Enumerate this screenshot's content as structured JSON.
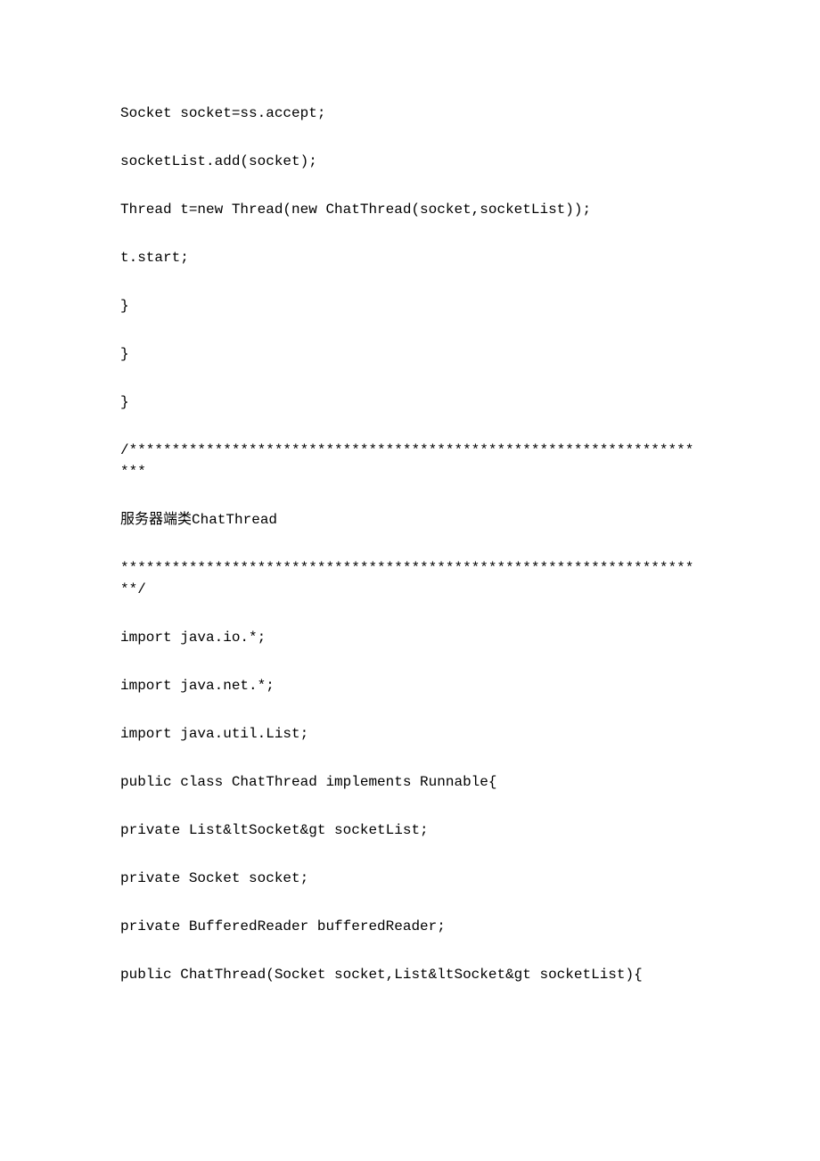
{
  "lines": [
    "Socket socket=ss.accept;",
    "socketList.add(socket);",
    "Thread t=new Thread(new ChatThread(socket,socketList));",
    "t.start;",
    "}",
    "}",
    "}",
    "/*********************************************************************",
    "服务器端类ChatThread",
    "*********************************************************************/",
    "import java.io.*;",
    "import java.net.*;",
    "import java.util.List;",
    "public class ChatThread implements Runnable{",
    "private List&ltSocket&gt socketList;",
    "private Socket socket;",
    "private BufferedReader bufferedReader;",
    "public ChatThread(Socket socket,List&ltSocket&gt socketList){"
  ]
}
